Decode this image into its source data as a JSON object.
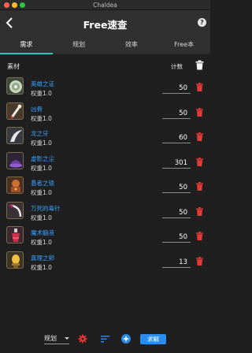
{
  "window": {
    "title": "Chaldea"
  },
  "appbar": {
    "back_glyph": "‹",
    "title": "Free速查",
    "help_glyph": "?"
  },
  "tabs": [
    {
      "label": "需求",
      "active": true
    },
    {
      "label": "规划",
      "active": false
    },
    {
      "label": "效率",
      "active": false
    },
    {
      "label": "Free本",
      "active": false
    }
  ],
  "list_header": {
    "material": "素材",
    "count": "计数"
  },
  "items": [
    {
      "name": "英雄之证",
      "weight": "权重1.0",
      "count": "50",
      "icon": "hero-proof-icon"
    },
    {
      "name": "凶骨",
      "weight": "权重1.0",
      "count": "50",
      "icon": "evil-bone-icon"
    },
    {
      "name": "龙之牙",
      "weight": "权重1.0",
      "count": "60",
      "icon": "dragon-fang-icon"
    },
    {
      "name": "虚影之尘",
      "weight": "权重1.0",
      "count": "301",
      "icon": "void-dust-icon"
    },
    {
      "name": "愚者之锁",
      "weight": "权重1.0",
      "count": "50",
      "icon": "fool-chain-icon"
    },
    {
      "name": "万死的毒针",
      "weight": "权重1.0",
      "count": "50",
      "icon": "poison-needle-icon"
    },
    {
      "name": "魔术髓液",
      "weight": "权重1.0",
      "count": "50",
      "icon": "magic-fluid-icon"
    },
    {
      "name": "真理之卵",
      "weight": "权重1.0",
      "count": "13",
      "icon": "truth-egg-icon"
    }
  ],
  "bottom": {
    "plan_label": "规划",
    "solve_label": "求解"
  },
  "colors": {
    "accent": "#26c6c6",
    "link": "#3aa0ff",
    "delete": "#e53935",
    "solve": "#2a8cf0"
  }
}
